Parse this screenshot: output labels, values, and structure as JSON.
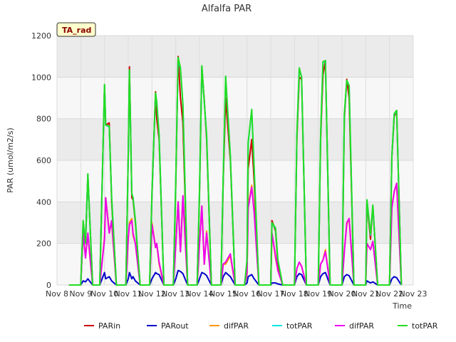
{
  "chart_data": {
    "type": "line",
    "title": "Alfalfa PAR",
    "xlabel": "Time",
    "ylabel": "PAR (umol/m2/s)",
    "badge": "TA_rad",
    "x_domain": [
      8,
      23
    ],
    "ylim": [
      0,
      1200
    ],
    "yticks": [
      0,
      200,
      400,
      600,
      800,
      1000,
      1200
    ],
    "xticks": [
      {
        "x": 8,
        "label": "Nov 8"
      },
      {
        "x": 9,
        "label": "Nov 9"
      },
      {
        "x": 10,
        "label": "Nov 10"
      },
      {
        "x": 11,
        "label": "Nov 11"
      },
      {
        "x": 12,
        "label": "Nov 12"
      },
      {
        "x": 13,
        "label": "Nov 13"
      },
      {
        "x": 14,
        "label": "Nov 14"
      },
      {
        "x": 15,
        "label": "Nov 15"
      },
      {
        "x": 16,
        "label": "Nov 16"
      },
      {
        "x": 17,
        "label": "Nov 17"
      },
      {
        "x": 18,
        "label": "Nov 18"
      },
      {
        "x": 19,
        "label": "Nov 19"
      },
      {
        "x": 20,
        "label": "Nov 20"
      },
      {
        "x": 21,
        "label": "Nov 21"
      },
      {
        "x": 22,
        "label": "Nov 22"
      },
      {
        "x": 23,
        "label": "Nov 23"
      }
    ],
    "grid": true,
    "legend_position": "bottom",
    "series": [
      {
        "name": "PARin",
        "color": "#cc0000",
        "x": [
          8.5,
          9.0,
          9.1,
          9.2,
          9.3,
          9.5,
          9.8,
          10.0,
          10.05,
          10.2,
          10.3,
          10.5,
          10.9,
          11.0,
          11.05,
          11.15,
          11.2,
          11.3,
          11.5,
          11.9,
          12.0,
          12.15,
          12.2,
          12.3,
          12.5,
          12.9,
          13.0,
          13.1,
          13.2,
          13.3,
          13.5,
          13.9,
          14.0,
          14.1,
          14.2,
          14.3,
          14.5,
          14.9,
          15.0,
          15.1,
          15.3,
          15.5,
          15.9,
          16.0,
          16.05,
          16.2,
          16.3,
          16.5,
          16.9,
          17.0,
          17.05,
          17.2,
          17.3,
          17.5,
          17.9,
          18.0,
          18.1,
          18.2,
          18.3,
          18.5,
          18.9,
          19.0,
          19.1,
          19.2,
          19.3,
          19.5,
          19.9,
          20.0,
          20.1,
          20.2,
          20.3,
          20.5,
          20.9,
          21.0,
          21.05,
          21.2,
          21.3,
          21.5,
          21.9,
          22.0,
          22.1,
          22.2,
          22.3,
          22.5
        ],
        "y": [
          0,
          0,
          280,
          200,
          530,
          0,
          0,
          960,
          770,
          780,
          400,
          0,
          0,
          630,
          1050,
          420,
          410,
          300,
          0,
          0,
          430,
          930,
          800,
          700,
          0,
          0,
          480,
          1100,
          900,
          780,
          0,
          0,
          430,
          1050,
          890,
          700,
          0,
          0,
          500,
          900,
          600,
          0,
          0,
          110,
          560,
          700,
          500,
          0,
          0,
          0,
          310,
          260,
          100,
          0,
          0,
          0,
          700,
          1000,
          990,
          0,
          0,
          0,
          700,
          1010,
          1080,
          0,
          0,
          0,
          800,
          990,
          900,
          0,
          0,
          0,
          400,
          220,
          380,
          0,
          0,
          0,
          620,
          810,
          840,
          0
        ]
      },
      {
        "name": "PARout",
        "color": "#0000cc",
        "x": [
          8.5,
          9.0,
          9.1,
          9.2,
          9.3,
          9.5,
          9.8,
          10.0,
          10.05,
          10.2,
          10.3,
          10.5,
          10.9,
          11.0,
          11.05,
          11.15,
          11.2,
          11.3,
          11.5,
          11.9,
          12.0,
          12.15,
          12.2,
          12.3,
          12.5,
          12.9,
          13.0,
          13.1,
          13.2,
          13.3,
          13.5,
          13.9,
          14.0,
          14.1,
          14.2,
          14.3,
          14.5,
          14.9,
          15.0,
          15.1,
          15.3,
          15.5,
          15.9,
          16.0,
          16.05,
          16.2,
          16.3,
          16.5,
          16.9,
          17.0,
          17.05,
          17.2,
          17.3,
          17.5,
          17.9,
          18.0,
          18.1,
          18.2,
          18.3,
          18.5,
          18.9,
          19.0,
          19.1,
          19.2,
          19.3,
          19.5,
          19.9,
          20.0,
          20.1,
          20.2,
          20.3,
          20.5,
          20.9,
          21.0,
          21.05,
          21.2,
          21.3,
          21.5,
          21.9,
          22.0,
          22.1,
          22.2,
          22.3,
          22.5
        ],
        "y": [
          0,
          0,
          20,
          15,
          30,
          0,
          0,
          60,
          30,
          40,
          20,
          0,
          0,
          30,
          60,
          30,
          40,
          20,
          0,
          0,
          30,
          60,
          55,
          50,
          0,
          0,
          30,
          70,
          65,
          55,
          0,
          0,
          30,
          60,
          55,
          45,
          0,
          0,
          40,
          60,
          40,
          0,
          0,
          10,
          40,
          50,
          30,
          0,
          0,
          0,
          10,
          10,
          5,
          0,
          0,
          0,
          40,
          55,
          50,
          0,
          0,
          0,
          40,
          55,
          60,
          0,
          0,
          0,
          40,
          50,
          45,
          0,
          0,
          0,
          20,
          10,
          15,
          0,
          0,
          0,
          30,
          40,
          35,
          0
        ]
      },
      {
        "name": "difPAR",
        "color": "#ff9900",
        "x": [
          8.5,
          9.0,
          9.1,
          9.2,
          9.3,
          9.5,
          9.8,
          10.0,
          10.05,
          10.2,
          10.3,
          10.5,
          10.9,
          11.0,
          11.05,
          11.15,
          11.2,
          11.3,
          11.5,
          11.9,
          12.0,
          12.15,
          12.2,
          12.3,
          12.5,
          12.9,
          13.0,
          13.1,
          13.2,
          13.3,
          13.5,
          13.9,
          14.0,
          14.1,
          14.2,
          14.3,
          14.5,
          14.9,
          15.0,
          15.1,
          15.3,
          15.5,
          15.9,
          16.0,
          16.05,
          16.2,
          16.3,
          16.5,
          16.9,
          17.0,
          17.05,
          17.2,
          17.3,
          17.5,
          17.9,
          18.0,
          18.1,
          18.2,
          18.3,
          18.5,
          18.9,
          19.0,
          19.1,
          19.2,
          19.3,
          19.5,
          19.9,
          20.0,
          20.1,
          20.2,
          20.3,
          20.5,
          20.9,
          21.0,
          21.05,
          21.2,
          21.3,
          21.5,
          21.9,
          22.0,
          22.1,
          22.2,
          22.3,
          22.5
        ],
        "y": [
          0,
          0,
          250,
          140,
          240,
          0,
          0,
          230,
          420,
          260,
          300,
          0,
          0,
          220,
          300,
          320,
          240,
          200,
          0,
          0,
          300,
          180,
          200,
          100,
          0,
          0,
          200,
          400,
          160,
          420,
          0,
          0,
          200,
          380,
          100,
          260,
          0,
          0,
          100,
          100,
          140,
          0,
          0,
          50,
          380,
          480,
          360,
          0,
          0,
          0,
          250,
          130,
          70,
          0,
          0,
          0,
          80,
          110,
          90,
          0,
          0,
          0,
          100,
          120,
          170,
          0,
          0,
          0,
          170,
          290,
          320,
          0,
          0,
          0,
          200,
          170,
          210,
          0,
          0,
          0,
          380,
          450,
          480,
          0
        ]
      },
      {
        "name": "totPAR",
        "color": "#00e5e5",
        "x": [
          8.5,
          9.0,
          9.1,
          9.2,
          9.3,
          9.5,
          9.8,
          10.0,
          10.05,
          10.2,
          10.3,
          10.5,
          10.9,
          11.0,
          11.05,
          11.15,
          11.2,
          11.3,
          11.5,
          11.9,
          12.0,
          12.15,
          12.2,
          12.3,
          12.5,
          12.9,
          13.0,
          13.1,
          13.2,
          13.3,
          13.5,
          13.9,
          14.0,
          14.1,
          14.2,
          14.3,
          14.5,
          14.9,
          15.0,
          15.1,
          15.3,
          15.5,
          15.9,
          16.0,
          16.05,
          16.2,
          16.3,
          16.5,
          16.9,
          17.0,
          17.05,
          17.2,
          17.3,
          17.5,
          17.9,
          18.0,
          18.1,
          18.2,
          18.3,
          18.5,
          18.9,
          19.0,
          19.1,
          19.2,
          19.3,
          19.5,
          19.9,
          20.0,
          20.1,
          20.2,
          20.3,
          20.5,
          20.9,
          21.0,
          21.05,
          21.2,
          21.3,
          21.5,
          21.9,
          22.0,
          22.1,
          22.2,
          22.3,
          22.5
        ],
        "y": [
          0,
          0,
          300,
          200,
          530,
          0,
          0,
          960,
          770,
          760,
          420,
          0,
          0,
          620,
          1030,
          440,
          420,
          310,
          0,
          0,
          440,
          920,
          880,
          720,
          0,
          0,
          500,
          1090,
          1040,
          870,
          0,
          0,
          450,
          1050,
          880,
          720,
          0,
          0,
          520,
          1000,
          620,
          0,
          0,
          120,
          680,
          840,
          560,
          0,
          0,
          0,
          300,
          270,
          120,
          0,
          0,
          0,
          720,
          1040,
          1000,
          0,
          0,
          0,
          720,
          1070,
          1080,
          0,
          0,
          0,
          820,
          980,
          960,
          0,
          0,
          0,
          410,
          240,
          380,
          0,
          0,
          0,
          620,
          820,
          840,
          0
        ]
      },
      {
        "name": "difPAR",
        "color": "#ee00ee",
        "x": [
          8.5,
          9.0,
          9.1,
          9.2,
          9.3,
          9.5,
          9.8,
          10.0,
          10.05,
          10.2,
          10.3,
          10.5,
          10.9,
          11.0,
          11.05,
          11.15,
          11.2,
          11.3,
          11.5,
          11.9,
          12.0,
          12.15,
          12.2,
          12.3,
          12.5,
          12.9,
          13.0,
          13.1,
          13.2,
          13.3,
          13.5,
          13.9,
          14.0,
          14.1,
          14.2,
          14.3,
          14.5,
          14.9,
          15.0,
          15.1,
          15.3,
          15.5,
          15.9,
          16.0,
          16.05,
          16.2,
          16.3,
          16.5,
          16.9,
          17.0,
          17.05,
          17.2,
          17.3,
          17.5,
          17.9,
          18.0,
          18.1,
          18.2,
          18.3,
          18.5,
          18.9,
          19.0,
          19.1,
          19.2,
          19.3,
          19.5,
          19.9,
          20.0,
          20.1,
          20.2,
          20.3,
          20.5,
          20.9,
          21.0,
          21.05,
          21.2,
          21.3,
          21.5,
          21.9,
          22.0,
          22.1,
          22.2,
          22.3,
          22.5
        ],
        "y": [
          0,
          0,
          250,
          130,
          250,
          0,
          0,
          220,
          420,
          250,
          310,
          0,
          0,
          230,
          290,
          310,
          250,
          200,
          0,
          0,
          290,
          180,
          200,
          110,
          0,
          0,
          190,
          400,
          160,
          430,
          0,
          0,
          200,
          380,
          100,
          250,
          0,
          0,
          100,
          110,
          150,
          0,
          0,
          60,
          370,
          470,
          350,
          0,
          0,
          0,
          250,
          140,
          70,
          0,
          0,
          0,
          80,
          110,
          90,
          0,
          0,
          0,
          100,
          120,
          160,
          0,
          0,
          0,
          160,
          300,
          320,
          0,
          0,
          0,
          200,
          170,
          210,
          0,
          0,
          0,
          370,
          450,
          490,
          0
        ]
      },
      {
        "name": "totPAR",
        "color": "#22dd22",
        "x": [
          8.5,
          9.0,
          9.1,
          9.2,
          9.3,
          9.5,
          9.8,
          10.0,
          10.05,
          10.2,
          10.3,
          10.5,
          10.9,
          11.0,
          11.05,
          11.15,
          11.2,
          11.3,
          11.5,
          11.9,
          12.0,
          12.15,
          12.2,
          12.3,
          12.5,
          12.9,
          13.0,
          13.1,
          13.2,
          13.3,
          13.5,
          13.9,
          14.0,
          14.1,
          14.2,
          14.3,
          14.5,
          14.9,
          15.0,
          15.1,
          15.3,
          15.5,
          15.9,
          16.0,
          16.05,
          16.2,
          16.3,
          16.5,
          16.9,
          17.0,
          17.05,
          17.2,
          17.3,
          17.5,
          17.9,
          18.0,
          18.1,
          18.2,
          18.3,
          18.5,
          18.9,
          19.0,
          19.1,
          19.2,
          19.3,
          19.5,
          19.9,
          20.0,
          20.1,
          20.2,
          20.3,
          20.5,
          20.9,
          21.0,
          21.05,
          21.2,
          21.3,
          21.5,
          21.9,
          22.0,
          22.1,
          22.2,
          22.3,
          22.5
        ],
        "y": [
          0,
          0,
          310,
          200,
          535,
          0,
          0,
          965,
          770,
          765,
          420,
          0,
          0,
          620,
          1035,
          440,
          420,
          310,
          0,
          0,
          450,
          925,
          880,
          720,
          0,
          0,
          500,
          1095,
          1045,
          870,
          0,
          0,
          455,
          1055,
          880,
          720,
          0,
          0,
          520,
          1005,
          620,
          0,
          0,
          120,
          685,
          845,
          560,
          0,
          0,
          0,
          300,
          275,
          120,
          0,
          0,
          0,
          725,
          1045,
          1000,
          0,
          0,
          0,
          725,
          1075,
          1080,
          0,
          0,
          0,
          825,
          985,
          960,
          0,
          0,
          0,
          410,
          245,
          385,
          0,
          0,
          0,
          620,
          825,
          840,
          0
        ]
      }
    ]
  }
}
